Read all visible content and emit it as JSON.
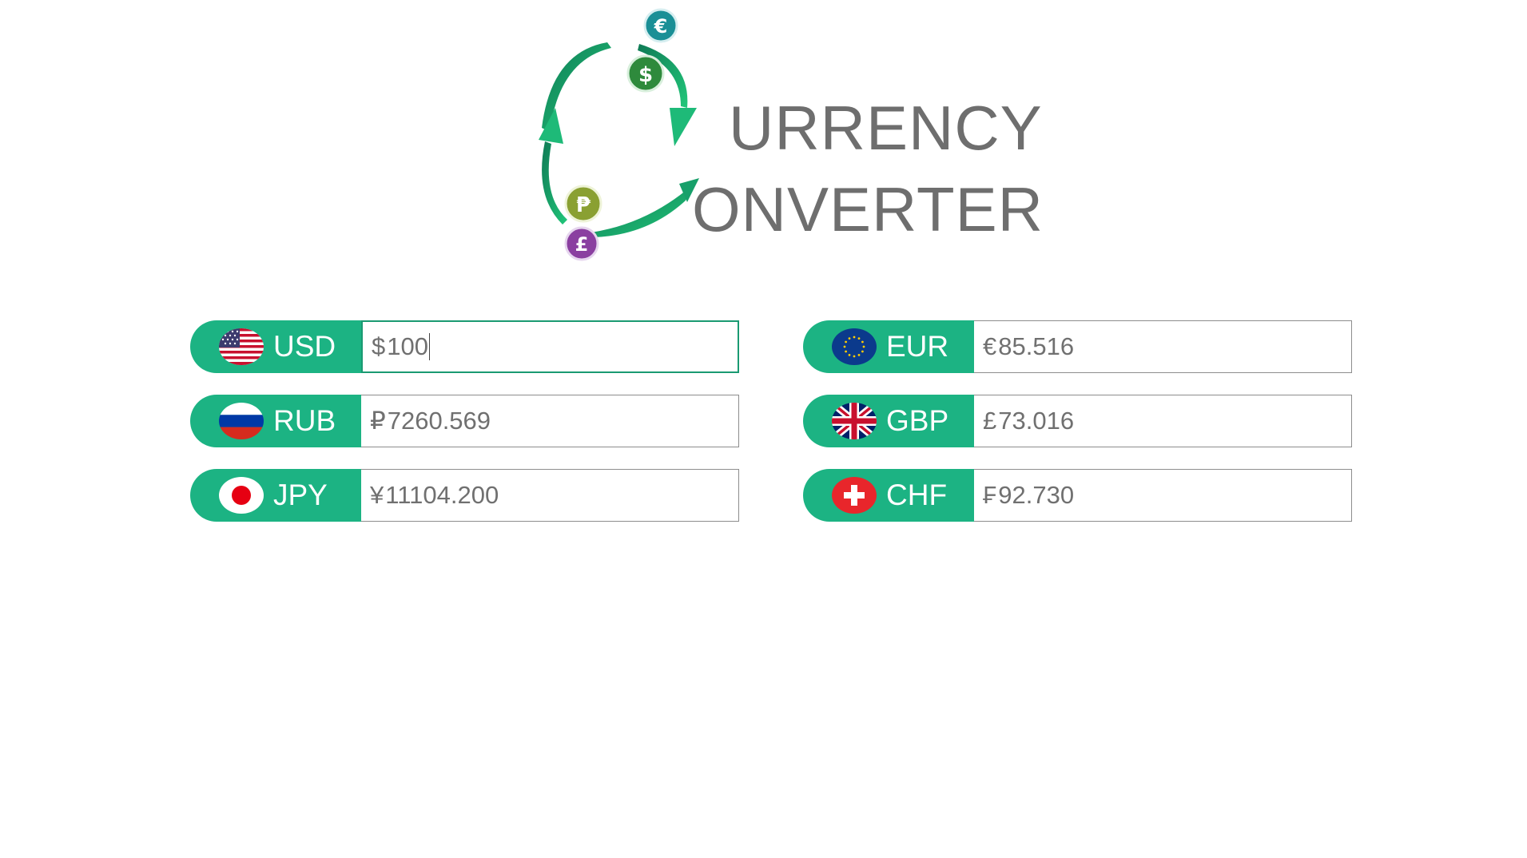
{
  "logo": {
    "line1": "URRENCY",
    "line2": "ONVERTER",
    "coins": [
      {
        "symbol": "€",
        "color": "#1a8f96"
      },
      {
        "symbol": "$",
        "color": "#2e8a3c"
      },
      {
        "symbol": "₱",
        "color": "#8aa032"
      },
      {
        "symbol": "£",
        "color": "#8a3fa0"
      }
    ]
  },
  "colors": {
    "accent": "#1cb383",
    "active_border": "#1a9a72",
    "text": "#707070"
  },
  "currencies": [
    {
      "code": "USD",
      "symbol": "$",
      "value": "100",
      "flag": "usa-flag-icon",
      "active": true
    },
    {
      "code": "RUB",
      "symbol": "₽",
      "value": "7260.569",
      "flag": "russia-flag-icon",
      "active": false
    },
    {
      "code": "JPY",
      "symbol": "¥",
      "value": "11104.200",
      "flag": "japan-flag-icon",
      "active": false
    },
    {
      "code": "EUR",
      "symbol": "€",
      "value": "85.516",
      "flag": "eu-flag-icon",
      "active": false
    },
    {
      "code": "GBP",
      "symbol": "£",
      "value": "73.016",
      "flag": "uk-flag-icon",
      "active": false
    },
    {
      "code": "CHF",
      "symbol": "₣",
      "value": "92.730",
      "flag": "switzerland-flag-icon",
      "active": false
    }
  ]
}
